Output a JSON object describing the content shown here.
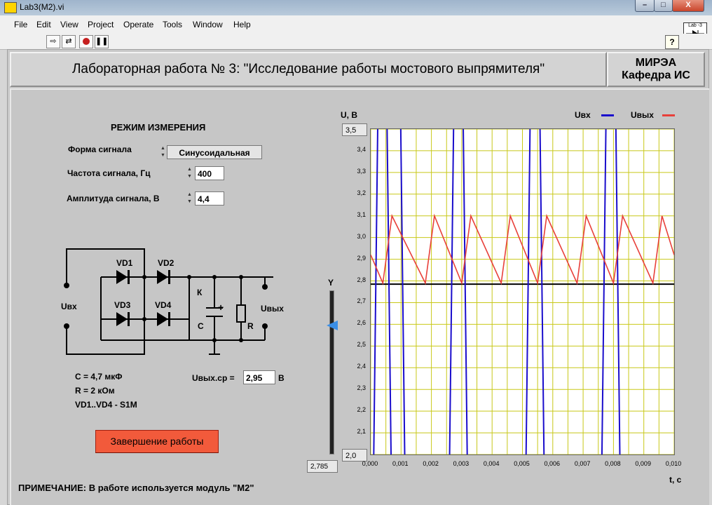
{
  "window": {
    "title": "Lab3(M2).vi",
    "min": "–",
    "max": "□",
    "close": "X"
  },
  "menu": [
    "File",
    "Edit",
    "View",
    "Project",
    "Operate",
    "Tools",
    "Window",
    "Help"
  ],
  "toolbar_icons": [
    "run-arrow-icon",
    "run-continuously-icon",
    "abort-icon",
    "pause-icon"
  ],
  "help_label": "?",
  "vi_icon_text": "Lab -3",
  "header": {
    "title": "Лабораторная работа № 3: \"Исследование работы мостового выпрямителя\"",
    "org_line1": "МИРЭА",
    "org_line2": "Кафедра ИС"
  },
  "controls": {
    "section_title": "РЕЖИМ ИЗМЕРЕНИЯ",
    "signal_form_label": "Форма сигнала",
    "signal_form_value": "Синусоидальная",
    "frequency_label": "Частота сигнала, Гц",
    "frequency_value": "400",
    "amplitude_label": "Амплитуда сигнала, В",
    "amplitude_value": "4,4"
  },
  "circuit": {
    "vd1": "VD1",
    "vd2": "VD2",
    "vd3": "VD3",
    "vd4": "VD4",
    "k": "К",
    "c": "С",
    "r": "R",
    "plus": "+",
    "uin": "Uвх",
    "uout": "Uвых"
  },
  "components": {
    "c_line": "С =   4,7 мкФ",
    "r_line": "R = 2 кОм",
    "vd_line": "VD1..VD4 - S1M"
  },
  "uout_avg": {
    "label": "Uвых.ср =",
    "value": "2,95",
    "unit": "В"
  },
  "finish_button": "Завершение работы",
  "note": "ПРИМЕЧАНИЕ: В работе используется модуль \"М2\"",
  "slider": {
    "label": "Y",
    "value": "2,785",
    "level": 0.785
  },
  "colors": {
    "uin": "#1a0dcc",
    "uout": "#e8403a",
    "baseline": "#000000",
    "grid": "#c8c818",
    "finish": "#f25a3b"
  },
  "chart_data": {
    "type": "line",
    "ylabel": "U, В",
    "xlabel": "t, с",
    "xlim": [
      0,
      0.01
    ],
    "ylim": [
      2.0,
      3.5
    ],
    "y_ticks": [
      "3,4",
      "3,3",
      "3,2",
      "3,1",
      "3,0",
      "2,9",
      "2,8",
      "2,7",
      "2,6",
      "2,5",
      "2,4",
      "2,3",
      "2,2",
      "2,1"
    ],
    "y_max_label": "3,5",
    "y_min_label": "2,0",
    "x_ticks": [
      "0,000",
      "0,001",
      "0,002",
      "0,003",
      "0,004",
      "0,005",
      "0,006",
      "0,007",
      "0,008",
      "0,009",
      "0,010"
    ],
    "grid": true,
    "legend_position": "top-right",
    "baseline_y": 2.785,
    "series": [
      {
        "name": "Uвх",
        "segments": [
          {
            "x": [
              0.0001,
              0.00023
            ],
            "y": [
              2.0,
              3.5
            ]
          },
          {
            "x": [
              0.00054,
              0.00067
            ],
            "y": [
              3.5,
              2.0
            ]
          },
          {
            "x": [
              0.00099,
              0.00112
            ],
            "y": [
              3.5,
              2.0
            ]
          },
          {
            "x": [
              0.0026,
              0.00273
            ],
            "y": [
              2.0,
              3.5
            ]
          },
          {
            "x": [
              0.00305,
              0.00318
            ],
            "y": [
              3.5,
              2.0
            ]
          },
          {
            "x": [
              0.00512,
              0.00525
            ],
            "y": [
              2.0,
              3.5
            ]
          },
          {
            "x": [
              0.00558,
              0.00571
            ],
            "y": [
              3.5,
              2.0
            ]
          },
          {
            "x": [
              0.00762,
              0.00775
            ],
            "y": [
              2.0,
              3.5
            ]
          },
          {
            "x": [
              0.00808,
              0.00821
            ],
            "y": [
              3.5,
              2.0
            ]
          }
        ]
      },
      {
        "name": "Uвых",
        "x": [
          0.0,
          0.0004,
          0.0007,
          0.0018,
          0.0021,
          0.003,
          0.0033,
          0.0043,
          0.0046,
          0.0055,
          0.0058,
          0.0068,
          0.0071,
          0.008,
          0.0083,
          0.0093,
          0.0096,
          0.01
        ],
        "y": [
          2.92,
          2.79,
          3.1,
          2.79,
          3.1,
          2.79,
          3.1,
          2.79,
          3.1,
          2.79,
          3.1,
          2.79,
          3.1,
          2.79,
          3.1,
          2.79,
          3.1,
          2.92
        ]
      }
    ]
  }
}
